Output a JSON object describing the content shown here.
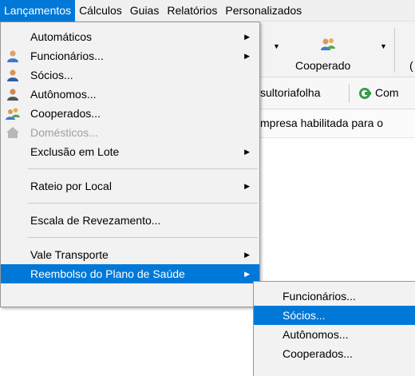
{
  "menubar": {
    "items": [
      "Lançamentos",
      "Cálculos",
      "Guias",
      "Relatórios",
      "Personalizados"
    ]
  },
  "background": {
    "cooperado_label": "Cooperado",
    "consultoria_text": "sultoriafolha",
    "com_text": "Com",
    "info_text": "mpresa habilitada para o"
  },
  "menu": {
    "items": [
      {
        "label": "Automáticos"
      },
      {
        "label": "Funcionários..."
      },
      {
        "label": "Sócios..."
      },
      {
        "label": "Autônomos..."
      },
      {
        "label": "Cooperados..."
      },
      {
        "label": "Domésticos..."
      },
      {
        "label": "Exclusão em Lote"
      },
      {
        "label": "Rateio por Local"
      },
      {
        "label": "Escala de Revezamento..."
      },
      {
        "label": "Vale Transporte"
      },
      {
        "label": "Reembolso do Plano de Saúde"
      }
    ]
  },
  "submenu": {
    "items": [
      {
        "label": "Funcionários..."
      },
      {
        "label": "Sócios..."
      },
      {
        "label": "Autônomos..."
      },
      {
        "label": "Cooperados..."
      }
    ]
  },
  "colors": {
    "highlight": "#0078d7",
    "menu_bg": "#f2f2f2",
    "disabled": "#a0a0a0"
  }
}
